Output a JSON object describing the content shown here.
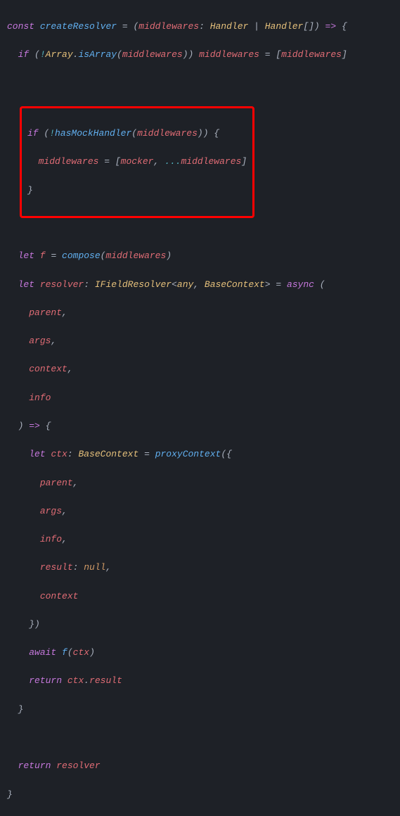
{
  "code": {
    "l1": {
      "const": "const",
      "fname": "createResolver",
      "eq": " = (",
      "param": "middlewares",
      "colon": ": ",
      "type1": "Handler",
      "pipe": " | ",
      "type2": "Handler",
      "brackets": "[]) ",
      "arrow": "=>",
      "brace": " {"
    },
    "l2": {
      "indent": "  ",
      "if": "if",
      "open": " (",
      "bang": "!",
      "ns": "Array",
      "dot": ".",
      "method": "isArray",
      "args": "(",
      "var": "middlewares",
      "close": ")) ",
      "var2": "middlewares",
      "assign": " = [",
      "var3": "middlewares",
      "end": "]"
    },
    "box": {
      "l1": {
        "if": "if",
        "open": " (",
        "bang": "!",
        "fn": "hasMockHandler",
        "args": "(",
        "var": "middlewares",
        "close": ")) {"
      },
      "l2": {
        "indent": "  ",
        "var": "middlewares",
        "assign": " = [",
        "mocker": "mocker",
        "comma": ", ",
        "spread": "...",
        "var2": "middlewares",
        "end": "]"
      },
      "l3": "}"
    },
    "l5": {
      "indent": "  ",
      "let": "let",
      "sp": " ",
      "var": "f",
      "eq": " = ",
      "fn": "compose",
      "args": "(",
      "param": "middlewares",
      "close": ")"
    },
    "l6": {
      "indent": "  ",
      "let": "let",
      "sp": " ",
      "var": "resolver",
      "colon": ": ",
      "type": "IFieldResolver",
      "lt": "<",
      "any": "any",
      "comma": ", ",
      "bc": "BaseContext",
      "gt": ">",
      "eq": " = ",
      "async": "async",
      "paren": " ("
    },
    "l7": {
      "indent": "    ",
      "name": "parent",
      "comma": ","
    },
    "l8": {
      "indent": "    ",
      "name": "args",
      "comma": ","
    },
    "l9": {
      "indent": "    ",
      "name": "context",
      "comma": ","
    },
    "l10": {
      "indent": "    ",
      "name": "info"
    },
    "l11": {
      "indent": "  ",
      "close": ") ",
      "arrow": "=>",
      "brace": " {"
    },
    "l12": {
      "indent": "    ",
      "let": "let",
      "sp": " ",
      "var": "ctx",
      "colon": ": ",
      "type": "BaseContext",
      "eq": " = ",
      "fn": "proxyContext",
      "open": "({"
    },
    "l13": {
      "indent": "      ",
      "name": "parent",
      "comma": ","
    },
    "l14": {
      "indent": "      ",
      "name": "args",
      "comma": ","
    },
    "l15": {
      "indent": "      ",
      "name": "info",
      "comma": ","
    },
    "l16": {
      "indent": "      ",
      "name": "result",
      "colon": ": ",
      "val": "null",
      "comma": ","
    },
    "l17": {
      "indent": "      ",
      "name": "context"
    },
    "l18": {
      "indent": "    ",
      "close": "})"
    },
    "l19": {
      "indent": "    ",
      "await": "await",
      "sp": " ",
      "fn": "f",
      "args": "(",
      "var": "ctx",
      "close": ")"
    },
    "l20": {
      "indent": "    ",
      "return": "return",
      "sp": " ",
      "var": "ctx",
      "dot": ".",
      "prop": "result"
    },
    "l21": {
      "indent": "  ",
      "brace": "}"
    },
    "l23": {
      "indent": "  ",
      "return": "return",
      "sp": " ",
      "var": "resolver"
    },
    "l24": "}"
  }
}
